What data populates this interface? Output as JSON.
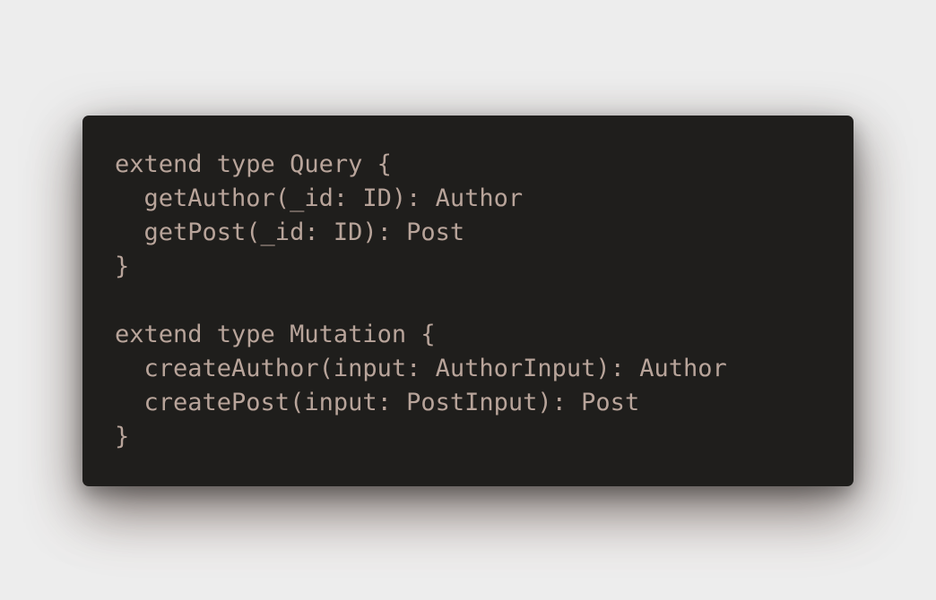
{
  "colors": {
    "page_background": "#ededed",
    "editor_background": "#1f1e1c",
    "code_text": "#b8a49a"
  },
  "code": {
    "language": "GraphQL",
    "lines": [
      "extend type Query {",
      "  getAuthor(_id: ID): Author",
      "  getPost(_id: ID): Post",
      "}",
      "",
      "extend type Mutation {",
      "  createAuthor(input: AuthorInput): Author",
      "  createPost(input: PostInput): Post",
      "}"
    ]
  }
}
